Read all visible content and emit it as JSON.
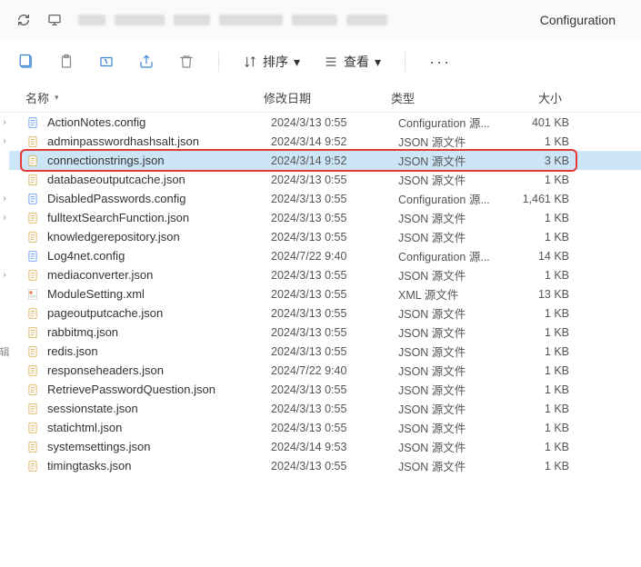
{
  "topbar": {
    "breadcrumb_final": "Configuration"
  },
  "toolbar": {
    "sort_label": "排序",
    "view_label": "查看"
  },
  "headers": {
    "name": "名称",
    "date": "修改日期",
    "type": "类型",
    "size": "大小"
  },
  "icon_colors": {
    "config": "#4b8bf4",
    "json": "#d9a441",
    "xml": "#e8762d"
  },
  "files": [
    {
      "icon": "config",
      "name": "ActionNotes.config",
      "date": "2024/3/13 0:55",
      "type": "Configuration 源...",
      "size": "401 KB",
      "selected": false
    },
    {
      "icon": "json",
      "name": "adminpasswordhashsalt.json",
      "date": "2024/3/14 9:52",
      "type": "JSON 源文件",
      "size": "1 KB",
      "selected": false
    },
    {
      "icon": "json",
      "name": "connectionstrings.json",
      "date": "2024/3/14 9:52",
      "type": "JSON 源文件",
      "size": "3 KB",
      "selected": true
    },
    {
      "icon": "json",
      "name": "databaseoutputcache.json",
      "date": "2024/3/13 0:55",
      "type": "JSON 源文件",
      "size": "1 KB",
      "selected": false
    },
    {
      "icon": "config",
      "name": "DisabledPasswords.config",
      "date": "2024/3/13 0:55",
      "type": "Configuration 源...",
      "size": "1,461 KB",
      "selected": false
    },
    {
      "icon": "json",
      "name": "fulltextSearchFunction.json",
      "date": "2024/3/13 0:55",
      "type": "JSON 源文件",
      "size": "1 KB",
      "selected": false
    },
    {
      "icon": "json",
      "name": "knowledgerepository.json",
      "date": "2024/3/13 0:55",
      "type": "JSON 源文件",
      "size": "1 KB",
      "selected": false
    },
    {
      "icon": "config",
      "name": "Log4net.config",
      "date": "2024/7/22 9:40",
      "type": "Configuration 源...",
      "size": "14 KB",
      "selected": false
    },
    {
      "icon": "json",
      "name": "mediaconverter.json",
      "date": "2024/3/13 0:55",
      "type": "JSON 源文件",
      "size": "1 KB",
      "selected": false
    },
    {
      "icon": "xml",
      "name": "ModuleSetting.xml",
      "date": "2024/3/13 0:55",
      "type": "XML 源文件",
      "size": "13 KB",
      "selected": false
    },
    {
      "icon": "json",
      "name": "pageoutputcache.json",
      "date": "2024/3/13 0:55",
      "type": "JSON 源文件",
      "size": "1 KB",
      "selected": false
    },
    {
      "icon": "json",
      "name": "rabbitmq.json",
      "date": "2024/3/13 0:55",
      "type": "JSON 源文件",
      "size": "1 KB",
      "selected": false
    },
    {
      "icon": "json",
      "name": "redis.json",
      "date": "2024/3/13 0:55",
      "type": "JSON 源文件",
      "size": "1 KB",
      "selected": false
    },
    {
      "icon": "json",
      "name": "responseheaders.json",
      "date": "2024/7/22 9:40",
      "type": "JSON 源文件",
      "size": "1 KB",
      "selected": false
    },
    {
      "icon": "json",
      "name": "RetrievePasswordQuestion.json",
      "date": "2024/3/13 0:55",
      "type": "JSON 源文件",
      "size": "1 KB",
      "selected": false
    },
    {
      "icon": "json",
      "name": "sessionstate.json",
      "date": "2024/3/13 0:55",
      "type": "JSON 源文件",
      "size": "1 KB",
      "selected": false
    },
    {
      "icon": "json",
      "name": "statichtml.json",
      "date": "2024/3/13 0:55",
      "type": "JSON 源文件",
      "size": "1 KB",
      "selected": false
    },
    {
      "icon": "json",
      "name": "systemsettings.json",
      "date": "2024/3/14 9:53",
      "type": "JSON 源文件",
      "size": "1 KB",
      "selected": false
    },
    {
      "icon": "json",
      "name": "timingtasks.json",
      "date": "2024/3/13 0:55",
      "type": "JSON 源文件",
      "size": "1 KB",
      "selected": false
    }
  ]
}
